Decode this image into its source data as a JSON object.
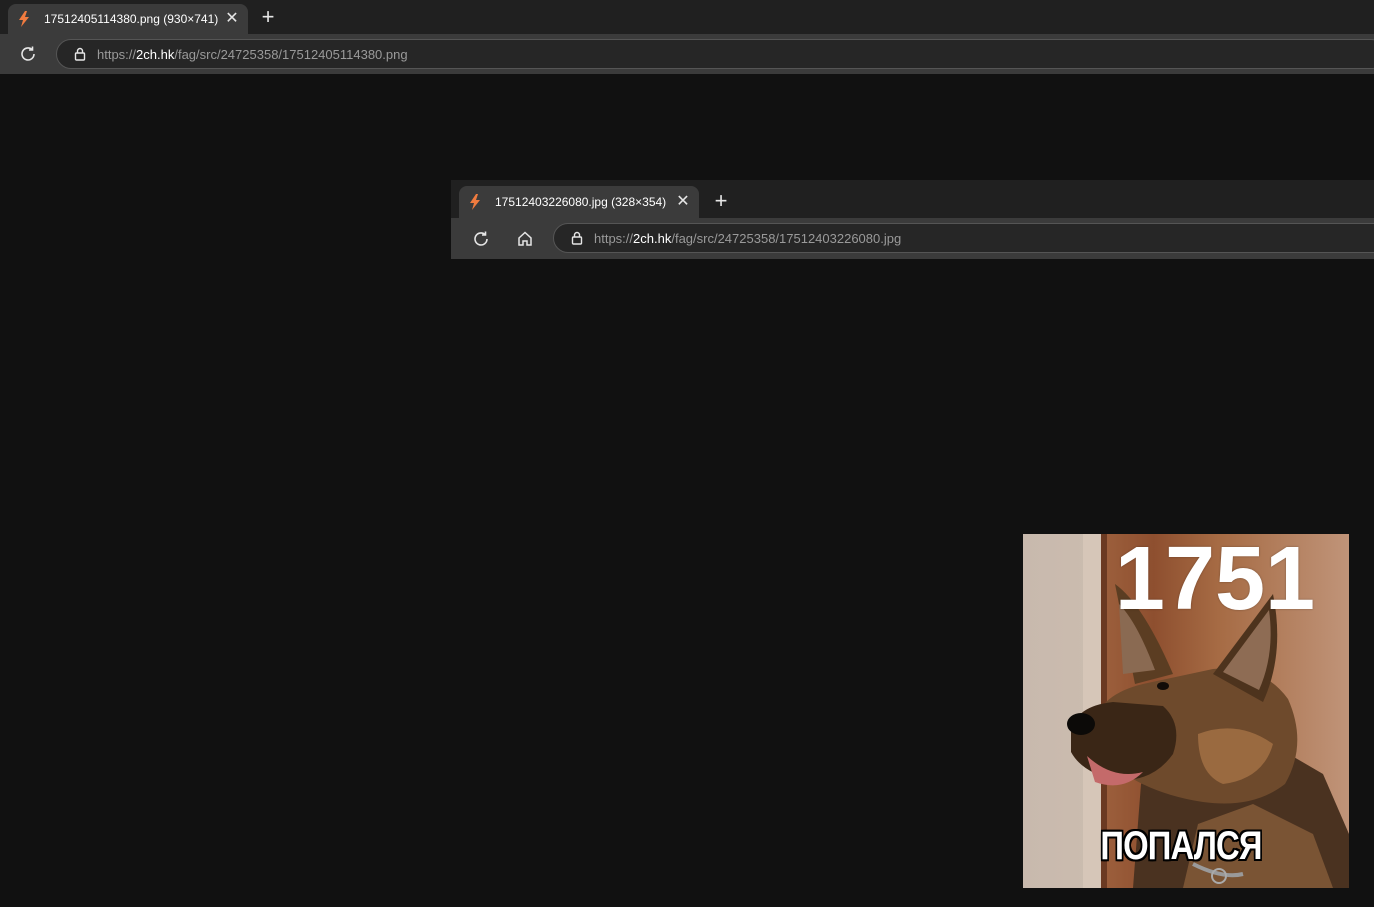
{
  "outer_browser": {
    "tab_title": "17512405114380.png (930×741)",
    "tab_close": "✕",
    "new_tab": "+",
    "url_prefix": "https://",
    "url_host": "2ch.hk",
    "url_path": "/fag/src/24725358/17512405114380.png"
  },
  "inner_browser": {
    "tab_title": "17512403226080.jpg (328×354)",
    "tab_close": "✕",
    "new_tab": "+",
    "url_prefix": "https://",
    "url_host": "2ch.hk",
    "url_path": "/fag/src/24725358/17512403226080.jpg"
  },
  "meme": {
    "number": "1751",
    "caption": "ПОПАЛСЯ"
  },
  "icons": {
    "favicon": "lightning-bolt-icon",
    "reload": "reload-icon",
    "home": "home-icon",
    "lock": "lock-icon"
  },
  "colors": {
    "favicon": "#f07b3f",
    "chrome_dark": "#202020",
    "chrome_tab": "#3b3b3b"
  }
}
